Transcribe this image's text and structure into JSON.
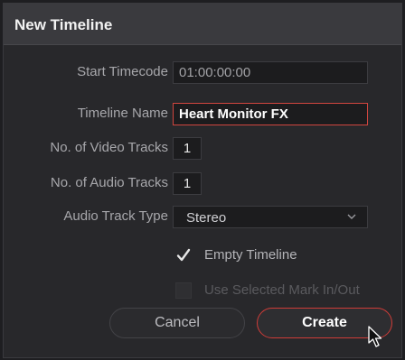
{
  "dialog": {
    "title": "New Timeline"
  },
  "fields": {
    "start_timecode": {
      "label": "Start Timecode",
      "value": "01:00:00:00"
    },
    "timeline_name": {
      "label": "Timeline Name",
      "value": "Heart Monitor FX"
    },
    "video_tracks": {
      "label": "No. of Video Tracks",
      "value": "1"
    },
    "audio_tracks": {
      "label": "No. of Audio Tracks",
      "value": "1"
    },
    "audio_track_type": {
      "label": "Audio Track Type",
      "value": "Stereo"
    }
  },
  "options": {
    "empty_timeline": {
      "label": "Empty Timeline",
      "checked": true
    },
    "use_mark_in_out": {
      "label": "Use Selected Mark In/Out",
      "checked": false,
      "enabled": false
    }
  },
  "buttons": {
    "cancel": "Cancel",
    "create": "Create"
  },
  "colors": {
    "accent": "#d1463f",
    "background": "#28282b",
    "titlebar": "#3a3a3e"
  },
  "icons": {
    "select_chevron": "chevron-down-icon",
    "checkmark": "checkmark-icon",
    "cursor": "mouse-pointer-icon"
  }
}
